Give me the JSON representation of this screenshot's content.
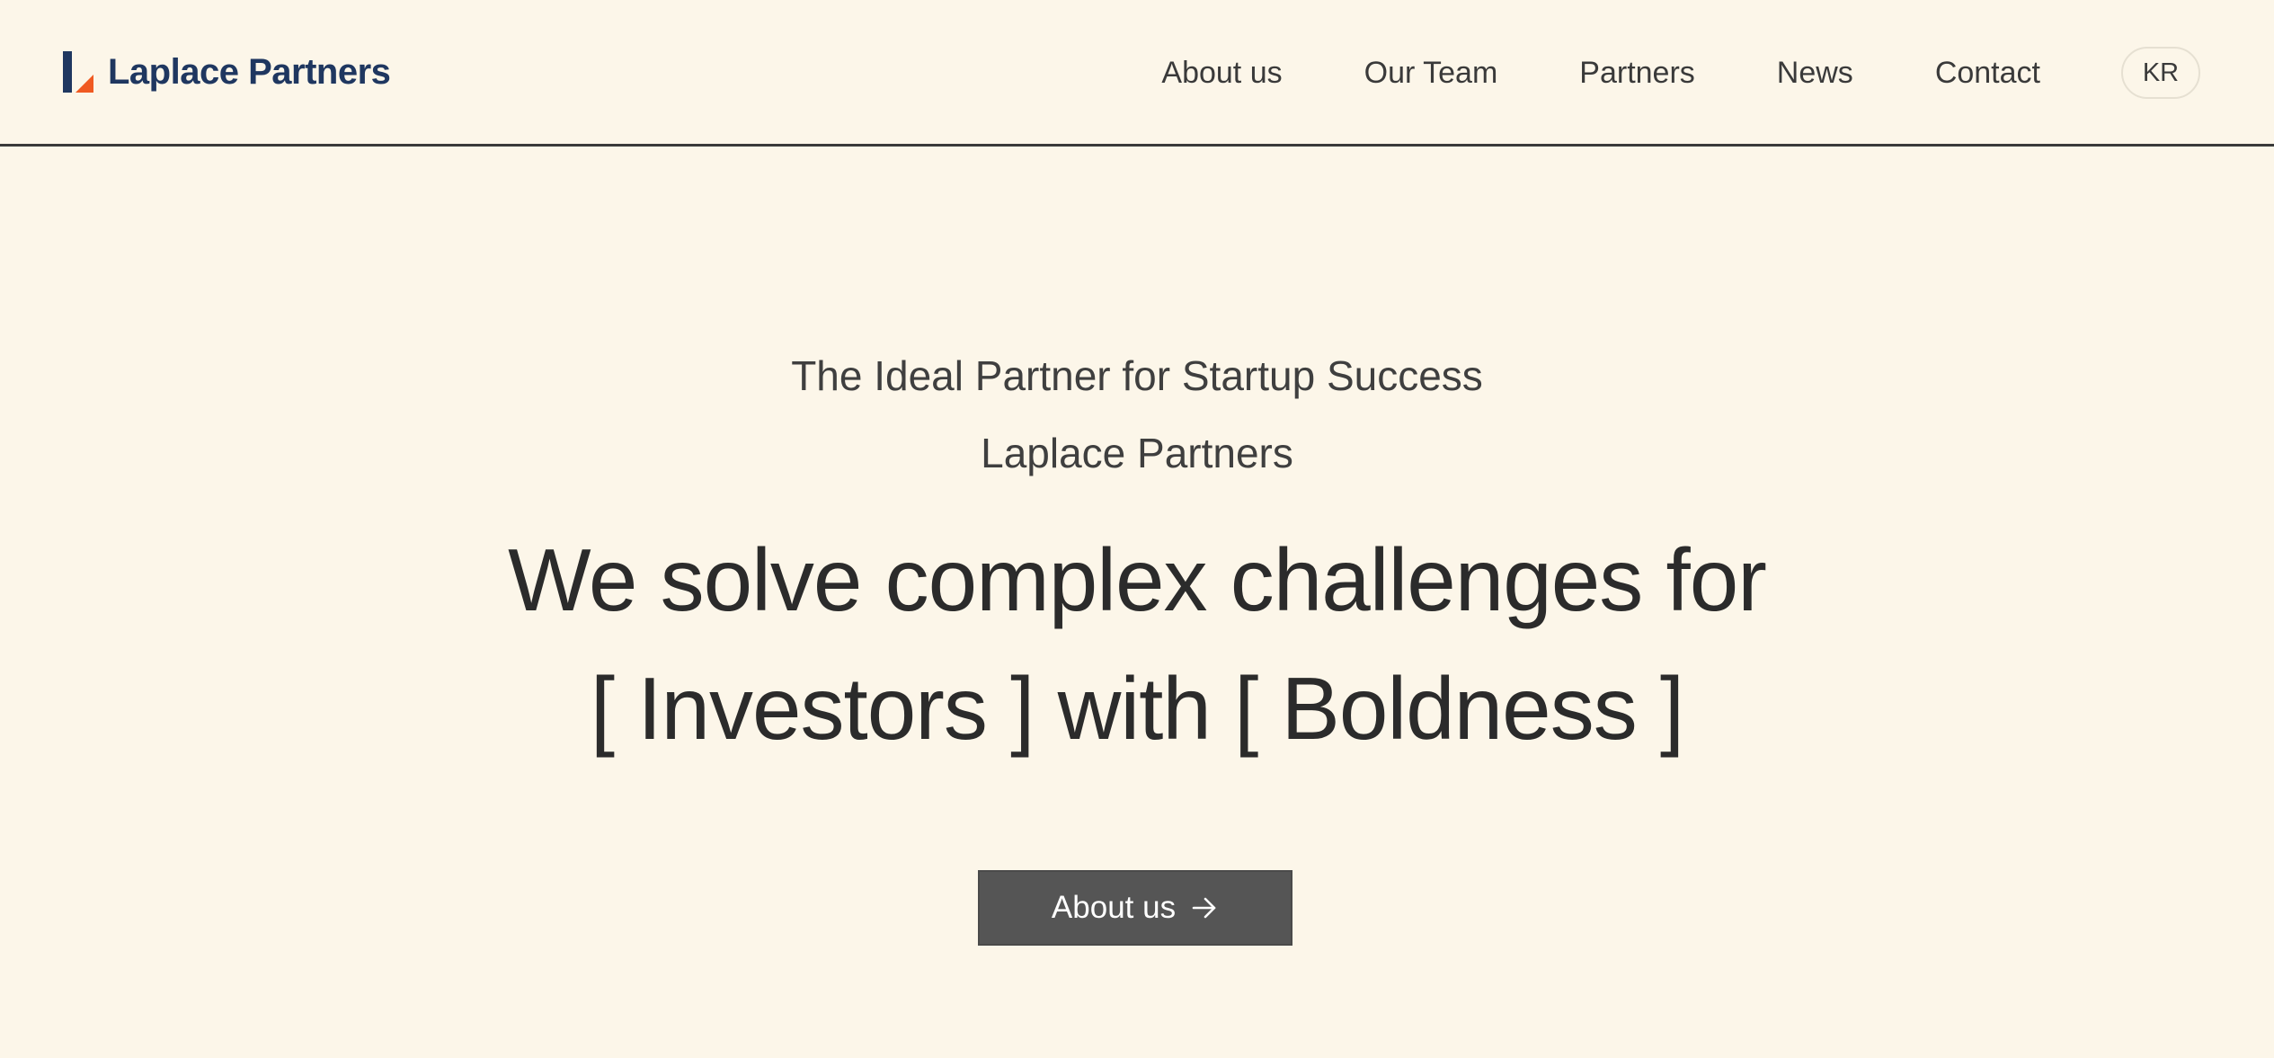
{
  "brand": {
    "name": "Laplace Partners",
    "logo_icon": "laplace-l-logo-icon",
    "colors": {
      "navy": "#1f3760",
      "orange": "#f05a22",
      "background": "#fcf6e9",
      "button": "#555555"
    }
  },
  "nav": {
    "items": [
      {
        "label": "About us"
      },
      {
        "label": "Our Team"
      },
      {
        "label": "Partners"
      },
      {
        "label": "News"
      },
      {
        "label": "Contact"
      }
    ],
    "language_toggle": "KR"
  },
  "hero": {
    "eyebrow": "The Ideal Partner for Startup Success",
    "company": "Laplace Partners",
    "headline_line1": "We solve complex challenges for",
    "headline_line2": "[ Investors ] with [ Boldness ]",
    "cta_label": "About us",
    "cta_icon": "arrow-right-icon"
  }
}
